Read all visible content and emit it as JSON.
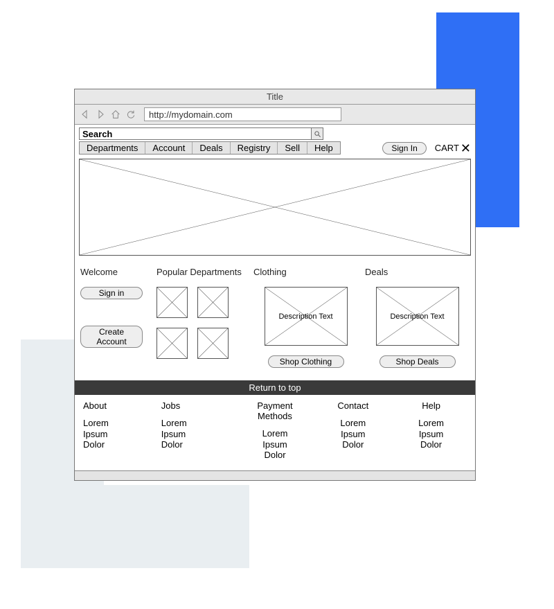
{
  "browser": {
    "title": "Title",
    "url": "http://mydomain.com"
  },
  "search": {
    "placeholder": "Search"
  },
  "menu": {
    "items": [
      "Departments",
      "Account",
      "Deals",
      "Registry",
      "Sell",
      "Help"
    ],
    "signin": "Sign In",
    "cart": "CART"
  },
  "sections": {
    "welcome": {
      "title": "Welcome",
      "signin": "Sign in",
      "create": "Create Account"
    },
    "popular": {
      "title": "Popular Departments"
    },
    "clothing": {
      "title": "Clothing",
      "desc": "Description Text",
      "button": "Shop Clothing"
    },
    "deals": {
      "title": "Deals",
      "desc": "Description Text",
      "button": "Shop Deals"
    }
  },
  "returntop": "Return to top",
  "footer": {
    "cols": [
      {
        "title": "About",
        "l1": "Lorem",
        "l2": "Ipsum",
        "l3": "Dolor"
      },
      {
        "title": "Jobs",
        "l1": "Lorem",
        "l2": "Ipsum",
        "l3": "Dolor"
      },
      {
        "title": "Payment Methods",
        "l1": "Lorem",
        "l2": "Ipsum",
        "l3": "Dolor"
      },
      {
        "title": "Contact",
        "l1": "Lorem",
        "l2": "Ipsum",
        "l3": "Dolor"
      },
      {
        "title": "Help",
        "l1": "Lorem",
        "l2": "Ipsum",
        "l3": "Dolor"
      }
    ]
  }
}
